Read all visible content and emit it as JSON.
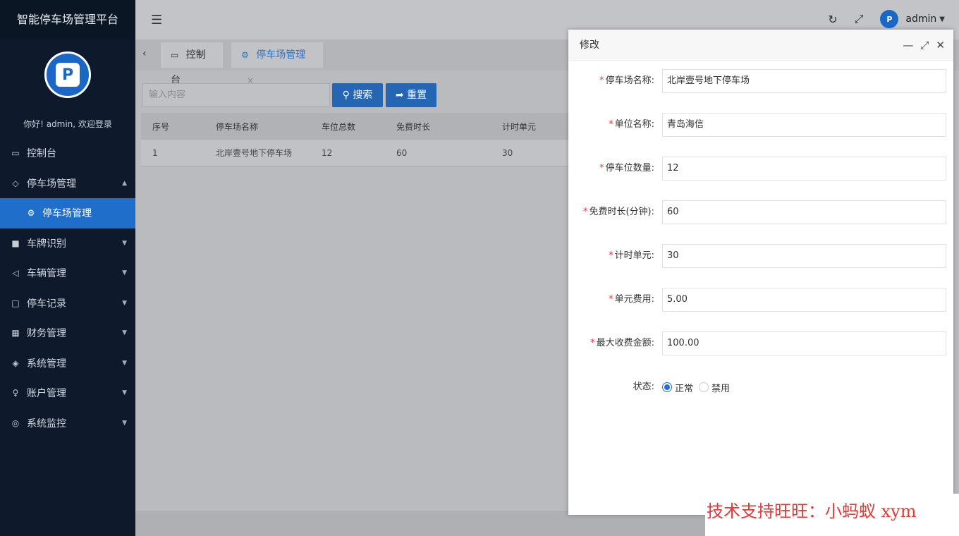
{
  "sidebar": {
    "title": "智能停车场管理平台",
    "welcome": "你好! admin, 欢迎登录",
    "items": [
      {
        "label": "控制台",
        "icon": "monitor-icon",
        "has_arrow": false
      },
      {
        "label": "停车场管理",
        "icon": "diamond-icon",
        "has_arrow": true,
        "expanded": true
      },
      {
        "label": "停车场管理",
        "icon": "gear-icon",
        "sub": true
      },
      {
        "label": "车牌识别",
        "icon": "camera-icon",
        "has_arrow": true
      },
      {
        "label": "车辆管理",
        "icon": "send-icon",
        "has_arrow": true
      },
      {
        "label": "停车记录",
        "icon": "file-icon",
        "has_arrow": true
      },
      {
        "label": "财务管理",
        "icon": "finance-icon",
        "has_arrow": true
      },
      {
        "label": "系统管理",
        "icon": "layers-icon",
        "has_arrow": true
      },
      {
        "label": "账户管理",
        "icon": "user-icon",
        "has_arrow": true
      },
      {
        "label": "系统监控",
        "icon": "monitor-cam-icon",
        "has_arrow": true
      }
    ]
  },
  "topbar": {
    "username": "admin"
  },
  "tabs": [
    {
      "label": "控制台",
      "icon": "monitor-icon"
    },
    {
      "label": "停车场管理",
      "icon": "gear-icon",
      "active": true
    }
  ],
  "search": {
    "placeholder": "输入内容",
    "search_label": "搜索",
    "reset_label": "重置"
  },
  "table": {
    "headers": [
      "序号",
      "停车场名称",
      "车位总数",
      "免费时长",
      "计时单元"
    ],
    "rows": [
      [
        "1",
        "北岸壹号地下停车场",
        "12",
        "60",
        "30"
      ]
    ]
  },
  "modal": {
    "title": "修改",
    "fields": [
      {
        "label": "停车场名称:",
        "value": "北岸壹号地下停车场",
        "required": true
      },
      {
        "label": "单位名称:",
        "value": "青岛海信",
        "required": true
      },
      {
        "label": "停车位数量:",
        "value": "12",
        "required": true
      },
      {
        "label": "免费时长(分钟):",
        "value": "60",
        "required": true
      },
      {
        "label": "计时单元:",
        "value": "30",
        "required": true
      },
      {
        "label": "单元费用:",
        "value": "5.00",
        "required": true
      },
      {
        "label": "最大收费金额:",
        "value": "100.00",
        "required": true
      }
    ],
    "status": {
      "label": "状态:",
      "options": [
        "正常",
        "禁用"
      ],
      "selected": "正常"
    }
  },
  "watermark": "技术支持旺旺：小蚂蚁 xym"
}
